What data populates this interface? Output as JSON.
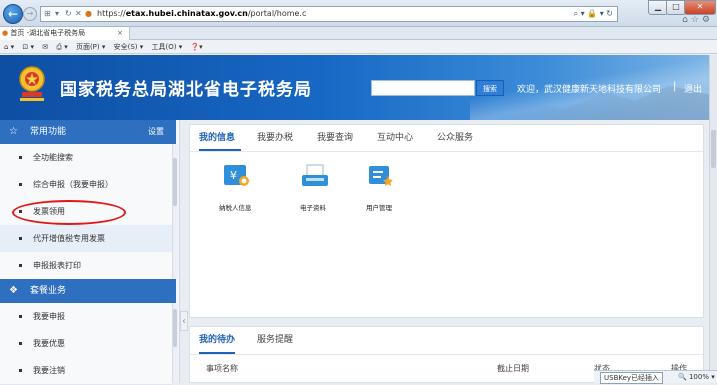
{
  "browser": {
    "url_prefix": "https://",
    "url_host": "etax.hubei.chinatax.gov.cn",
    "url_path": "/portal/home.c",
    "tab_title": "首页 -湖北省电子税务局",
    "command_bar": [
      "页面(P) ▾",
      "安全(S) ▾",
      "工具(O) ▾"
    ],
    "window_buttons": {
      "minimize": "▁",
      "maximize": "□",
      "close": "✕"
    }
  },
  "header": {
    "site_title": "国家税务总局湖北省电子税务局",
    "search_button": "搜索",
    "welcome_text": "欢迎，武汉健康新天地科技有限公司",
    "separator": "|",
    "logout": "退出"
  },
  "sidebar": {
    "common_header": {
      "label": "常用功能",
      "settings": "设置"
    },
    "common_items": [
      {
        "label": "全功能搜索"
      },
      {
        "label": "综合申报（我要申报）"
      },
      {
        "label": "发票领用"
      },
      {
        "label": "代开增值税专用发票"
      },
      {
        "label": "申报报表打印"
      }
    ],
    "package_header": {
      "label": "套餐业务"
    },
    "package_items": [
      {
        "label": "我要申报"
      },
      {
        "label": "我要优惠"
      },
      {
        "label": "我要注销"
      }
    ]
  },
  "main": {
    "tabs": [
      {
        "label": "我的信息",
        "active": true
      },
      {
        "label": "我要办税",
        "active": false
      },
      {
        "label": "我要查询",
        "active": false
      },
      {
        "label": "互动中心",
        "active": false
      },
      {
        "label": "公众服务",
        "active": false
      }
    ],
    "apps": [
      {
        "label": "纳税人信息",
        "icon": "taxpayer-info-icon"
      },
      {
        "label": "电子资料",
        "icon": "electronic-documents-icon"
      },
      {
        "label": "用户管理",
        "icon": "user-management-icon"
      }
    ],
    "bottom_tabs": [
      {
        "label": "我的待办",
        "active": true
      },
      {
        "label": "服务提醒",
        "active": false
      }
    ],
    "todo_columns": [
      "事项名称",
      "截止日期",
      "状态",
      "操作"
    ]
  },
  "statusbar": {
    "usbkey": "USBKey已经插入",
    "zoom": "100%"
  },
  "colors": {
    "brand_blue": "#1768c4",
    "sidebar_header": "#2f6fc0",
    "active_tab": "#1f62b8",
    "annotation_red": "#e01818"
  }
}
